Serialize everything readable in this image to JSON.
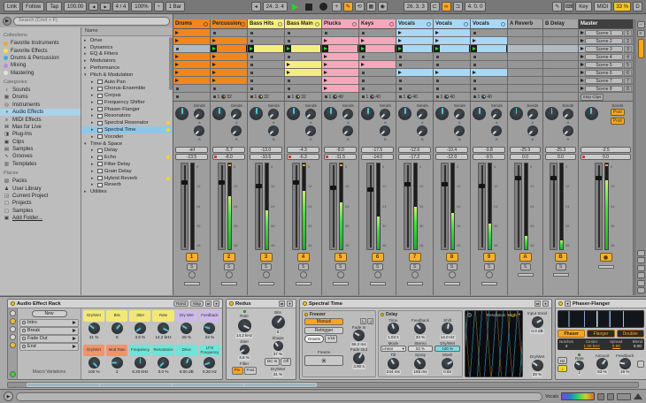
{
  "transport": {
    "link": "Link",
    "follow": "Follow",
    "tap": "Tap",
    "tempo": "100.00",
    "time_sig": "4 / 4",
    "groove_amount": "100%",
    "quantize": "1 Bar",
    "position": "24. 3. 4",
    "loop_start": "26. 3. 3",
    "loop_length": "4. 0. 0",
    "key": "Key",
    "midi": "MIDI",
    "cpu": "33 %",
    "disk": "D"
  },
  "browser": {
    "search_placeholder": "Search (Cmd + F)",
    "sections": {
      "collections": "Collections",
      "categories": "Categories",
      "places": "Places"
    },
    "collections": [
      {
        "label": "Favorite Instruments",
        "color": "#f5a33b"
      },
      {
        "label": "Favorite Effects",
        "color": "#f0e43c"
      },
      {
        "label": "Drums & Percussion",
        "color": "#4ba3e8"
      },
      {
        "label": "Mixing",
        "color": "#b98ae8"
      },
      {
        "label": "Mastering",
        "color": "#e0e0e0"
      }
    ],
    "categories": [
      {
        "label": "Sounds",
        "icon": "♪"
      },
      {
        "label": "Drums",
        "icon": "▦"
      },
      {
        "label": "Instruments",
        "icon": "◎"
      },
      {
        "label": "Audio Effects",
        "icon": "◑",
        "selected": true
      },
      {
        "label": "MIDI Effects",
        "icon": "≡"
      },
      {
        "label": "Max for Live",
        "icon": "⌘"
      },
      {
        "label": "Plug-Ins",
        "icon": "◨"
      },
      {
        "label": "Clips",
        "icon": "▣"
      },
      {
        "label": "Samples",
        "icon": "▤"
      },
      {
        "label": "Grooves",
        "icon": "∿"
      },
      {
        "label": "Templates",
        "icon": "▥"
      }
    ],
    "places": [
      {
        "label": "Packs",
        "icon": "▧"
      },
      {
        "label": "User Library",
        "icon": "♟"
      },
      {
        "label": "Current Project",
        "icon": "◲"
      },
      {
        "label": "Projects",
        "icon": "▢"
      },
      {
        "label": "Samples",
        "icon": "▢"
      },
      {
        "label": "Add Folder...",
        "icon": "▣",
        "underline": true
      }
    ],
    "tree_header": "Name",
    "tree": [
      {
        "label": "Drive",
        "type": "folder"
      },
      {
        "label": "Dynamics",
        "type": "folder"
      },
      {
        "label": "EQ & Filters",
        "type": "folder"
      },
      {
        "label": "Modulators",
        "type": "folder"
      },
      {
        "label": "Performance",
        "type": "folder"
      },
      {
        "label": "Pitch & Modulation",
        "type": "folder",
        "open": true
      },
      {
        "label": "Auto Pan",
        "type": "device",
        "depth": 1
      },
      {
        "label": "Chorus-Ensemble",
        "type": "device",
        "depth": 1
      },
      {
        "label": "Corpus",
        "type": "device",
        "depth": 1
      },
      {
        "label": "Frequency Shifter",
        "type": "device",
        "depth": 1
      },
      {
        "label": "Phaser-Flanger",
        "type": "device",
        "depth": 1
      },
      {
        "label": "Resonators",
        "type": "device",
        "depth": 1
      },
      {
        "label": "Spectral Resonator",
        "type": "device",
        "depth": 1,
        "fav": true
      },
      {
        "label": "Spectral Time",
        "type": "device",
        "depth": 1,
        "fav": true,
        "selected": true
      },
      {
        "label": "Vocoder",
        "type": "device",
        "depth": 1
      },
      {
        "label": "Time & Space",
        "type": "folder",
        "open": true
      },
      {
        "label": "Delay",
        "type": "device",
        "depth": 1
      },
      {
        "label": "Echo",
        "type": "device",
        "depth": 1,
        "fav": true
      },
      {
        "label": "Filter Delay",
        "type": "device",
        "depth": 1
      },
      {
        "label": "Grain Delay",
        "type": "device",
        "depth": 1
      },
      {
        "label": "Hybrid Reverb",
        "type": "device",
        "depth": 1,
        "fav": true
      },
      {
        "label": "Reverb",
        "type": "device",
        "depth": 1
      },
      {
        "label": "Utilities",
        "type": "folder"
      }
    ]
  },
  "session": {
    "sends_label": "Sends",
    "send_letters": [
      "A",
      "B"
    ],
    "solo_label": "S",
    "scale": [
      "0",
      "12",
      "24",
      "36",
      "48"
    ],
    "playing_row": 2,
    "tracks": [
      {
        "name": "Drums",
        "color": "#f1861f",
        "clips": [
          1,
          1,
          0,
          1,
          1,
          1,
          1,
          0
        ],
        "status_bars": "",
        "status_len": "",
        "peak": "-inf",
        "vol": "-13.5",
        "meter": 0.0,
        "fader": 0.8,
        "num": "1",
        "clip_red": false
      },
      {
        "name": "Percussion",
        "color": "#f1861f",
        "clips": [
          0,
          1,
          2,
          1,
          1,
          1,
          1,
          0
        ],
        "status_bars": "1",
        "status_len": "32",
        "peak": "-5.7",
        "vol": "-8.0",
        "meter": 0.62,
        "fader": 0.8,
        "num": "2",
        "clip_red": true
      },
      {
        "name": "Bass Hits",
        "color": "#f4ee7c",
        "clips": [
          0,
          0,
          2,
          0,
          0,
          0,
          0,
          0
        ],
        "status_bars": "1",
        "status_len": "32",
        "peak": "-13.0",
        "vol": "-10.6",
        "meter": 0.45,
        "fader": 0.76,
        "num": "3",
        "clip_red": false
      },
      {
        "name": "Bass Main",
        "color": "#f4ee7c",
        "clips": [
          0,
          0,
          2,
          0,
          1,
          1,
          0,
          0
        ],
        "status_bars": "1",
        "status_len": "32",
        "peak": "-4.3",
        "vol": "-6.3",
        "meter": 0.68,
        "fader": 0.8,
        "num": "4",
        "clip_red": true
      },
      {
        "name": "Plucks",
        "color": "#f5a8bc",
        "clips": [
          0,
          1,
          2,
          1,
          1,
          1,
          1,
          1
        ],
        "status_bars": "1",
        "status_len": "40",
        "peak": "-8.0",
        "vol": "-11.5",
        "meter": 0.55,
        "fader": 0.74,
        "num": "5",
        "clip_red": true
      },
      {
        "name": "Keys",
        "color": "#f5a8bc",
        "clips": [
          0,
          1,
          2,
          0,
          1,
          0,
          0,
          0
        ],
        "status_bars": "1",
        "status_len": "40",
        "peak": "-17.5",
        "vol": "-14.0",
        "meter": 0.38,
        "fader": 0.72,
        "num": "6",
        "clip_red": false
      },
      {
        "name": "Vocals",
        "color": "#a9d8f5",
        "clips": [
          1,
          1,
          2,
          0,
          0,
          1,
          0,
          0
        ],
        "status_bars": "1",
        "status_len": "40",
        "peak": "-12.6",
        "vol": "-17.2",
        "meter": 0.5,
        "fader": 0.78,
        "num": "7",
        "clip_red": false
      },
      {
        "name": "Vocals",
        "color": "#a9d8f5",
        "clips": [
          1,
          1,
          2,
          0,
          0,
          1,
          0,
          0
        ],
        "status_bars": "1",
        "status_len": "40",
        "peak": "-10.4",
        "vol": "-12.0",
        "meter": 0.42,
        "fader": 0.78,
        "num": "8",
        "clip_red": false
      },
      {
        "name": "Vocals",
        "color": "#a9d8f5",
        "clips": [
          0,
          1,
          2,
          0,
          0,
          1,
          0,
          0
        ],
        "status_bars": "1",
        "status_len": "40",
        "peak": "-9.8",
        "vol": "-9.5",
        "meter": 0.3,
        "fader": 0.76,
        "num": "9",
        "clip_red": false
      }
    ],
    "returns": [
      {
        "name": "A Reverb",
        "num": "A",
        "peak": "-25.9",
        "vol": "0.0",
        "meter": 0.15,
        "fader": 0.86,
        "clip_red": false
      },
      {
        "name": "B Delay",
        "num": "B",
        "peak": "-25.3",
        "vol": "0.0",
        "meter": 0.1,
        "fader": 0.86,
        "clip_red": false
      }
    ],
    "master": {
      "name": "Master",
      "stop_clips": "Stop Clips",
      "post_buttons": [
        "Post",
        "Post"
      ],
      "peak": "-2.5",
      "vol": "0.0",
      "meter": 0.8,
      "fader": 0.86,
      "clip_red": true,
      "scenes": [
        {
          "name": "Scene 1",
          "num": "1"
        },
        {
          "name": "Scene 2",
          "num": "2"
        },
        {
          "name": "Scene 3",
          "num": "3"
        },
        {
          "name": "Scene 4",
          "num": "4"
        },
        {
          "name": "Scene 5",
          "num": "5"
        },
        {
          "name": "Scene 6",
          "num": "6"
        },
        {
          "name": "Scene 7",
          "num": "7"
        },
        {
          "name": "Scene 8",
          "num": "8"
        }
      ]
    }
  },
  "devices": {
    "rack": {
      "title": "Audio Effect Rack",
      "rand": "Rand",
      "map": "Map",
      "new_label": "New",
      "variations": [
        "Intro",
        "Break",
        "Fade Out",
        "End"
      ],
      "variations_label": "Macro Variations",
      "macros": [
        {
          "label": "Dry/Wet",
          "value": "31 %",
          "color": "#f2e878",
          "angle": -51
        },
        {
          "label": "Bits",
          "value": "8",
          "color": "#f2e878",
          "angle": 40
        },
        {
          "label": "Jitter",
          "value": "3.6 %",
          "color": "#f2e878",
          "angle": -125
        },
        {
          "label": "Rate",
          "value": "14.2 kHz",
          "color": "#f2e878",
          "angle": 115
        },
        {
          "label": "Dry Wet",
          "value": "28 %",
          "color": "#cdb9ea",
          "angle": -59
        },
        {
          "label": "Feedback",
          "value": "23 %",
          "color": "#cdb9ea",
          "angle": -73
        },
        {
          "label": "Dry/Wet",
          "value": "100 %",
          "color": "#f2936b",
          "angle": 135
        },
        {
          "label": "Mod Rate",
          "value": "2",
          "color": "#f2936b",
          "angle": -90
        },
        {
          "label": "Frequency",
          "value": "6.20 kHz",
          "color": "#6fe4d8",
          "angle": 0
        },
        {
          "label": "Resonance",
          "value": "0.0 %",
          "color": "#6fe4d8",
          "angle": -135
        },
        {
          "label": "Drive",
          "value": "8.00 dB",
          "color": "#6fe4d8",
          "angle": 20
        },
        {
          "label": "LFO Frequency",
          "value": "0.20 Hz",
          "color": "#6fe4d8",
          "angle": -110
        }
      ]
    },
    "redux": {
      "title": "Redux",
      "rate_label": "Rate",
      "rate": "14.2 kHz",
      "jitter_label": "Jitter",
      "jitter": "3.6 %",
      "bits_label": "Bits",
      "bits": "8",
      "shape_label": "Shape",
      "shape": "37 %",
      "filter_label": "Filter",
      "pre": "Pre",
      "post": "Post",
      "filter_value": "0.00",
      "dc_label": "DC In",
      "dc_state": "Off",
      "dry_wet_label": "Dry/Wet",
      "dry_wet": "31 %"
    },
    "spectral_time": {
      "title": "Spectral Time",
      "freezer": {
        "label": "Freezer",
        "manual": "Manual",
        "retrigger": "Retrigger",
        "onsets": "Onsets",
        "sync_value": "1/16",
        "fade_in_label": "Fade In",
        "fade_in": "55.2 ms",
        "fade_out_label": "Fade Out",
        "fade_out": "3.80 s",
        "freeze_label": "Freeze",
        "freeze_glyph": "✳"
      },
      "delay": {
        "label": "Delay",
        "time_label": "Time",
        "time": "1.03 s",
        "feedback_label": "Feedback",
        "feedback": "33 %",
        "shift_label": "Shift",
        "shift": "14.0 Hz",
        "mode_label": "Mode",
        "mode": "Linear",
        "stereo_label": "Stereo",
        "stereo": "53 %",
        "dry_wet_label": "Dry/Wet",
        "dry_wet": "100 %",
        "tilt_label": "Tilt",
        "tilt": "244 ms",
        "spray_label": "Spray",
        "spray": "165 ms",
        "mask_label": "Mask",
        "mask": "0.82"
      },
      "display": {
        "resolution_label": "Resolution",
        "resolution": "High"
      },
      "output": {
        "input_send_label": "Input Send",
        "input_send": "0.0 dB",
        "dry_wet_label": "Dry/Wet",
        "dry_wet": "29 %"
      }
    },
    "phaser_flanger": {
      "title": "Phaser-Flanger",
      "modes": [
        "Phaser",
        "Flanger",
        "Doubler"
      ],
      "selected_mode": "Phaser",
      "params": [
        {
          "label": "Notches",
          "value": "4",
          "orange": false
        },
        {
          "label": "Center",
          "value": "1.00 kHz",
          "orange": true
        },
        {
          "label": "Spread",
          "value": "0.50",
          "orange": true
        },
        {
          "label": "Blend",
          "value": "0.00",
          "orange": false
        }
      ],
      "hz_label": "Hz",
      "note_label": "♪",
      "rate_label": "Rate",
      "rate": "2",
      "amount_label": "Amount",
      "amount": "63 %",
      "feedback_label": "Feedback",
      "feedback": "19 %"
    }
  },
  "status_bar": {
    "selected_track": "Vocals"
  }
}
